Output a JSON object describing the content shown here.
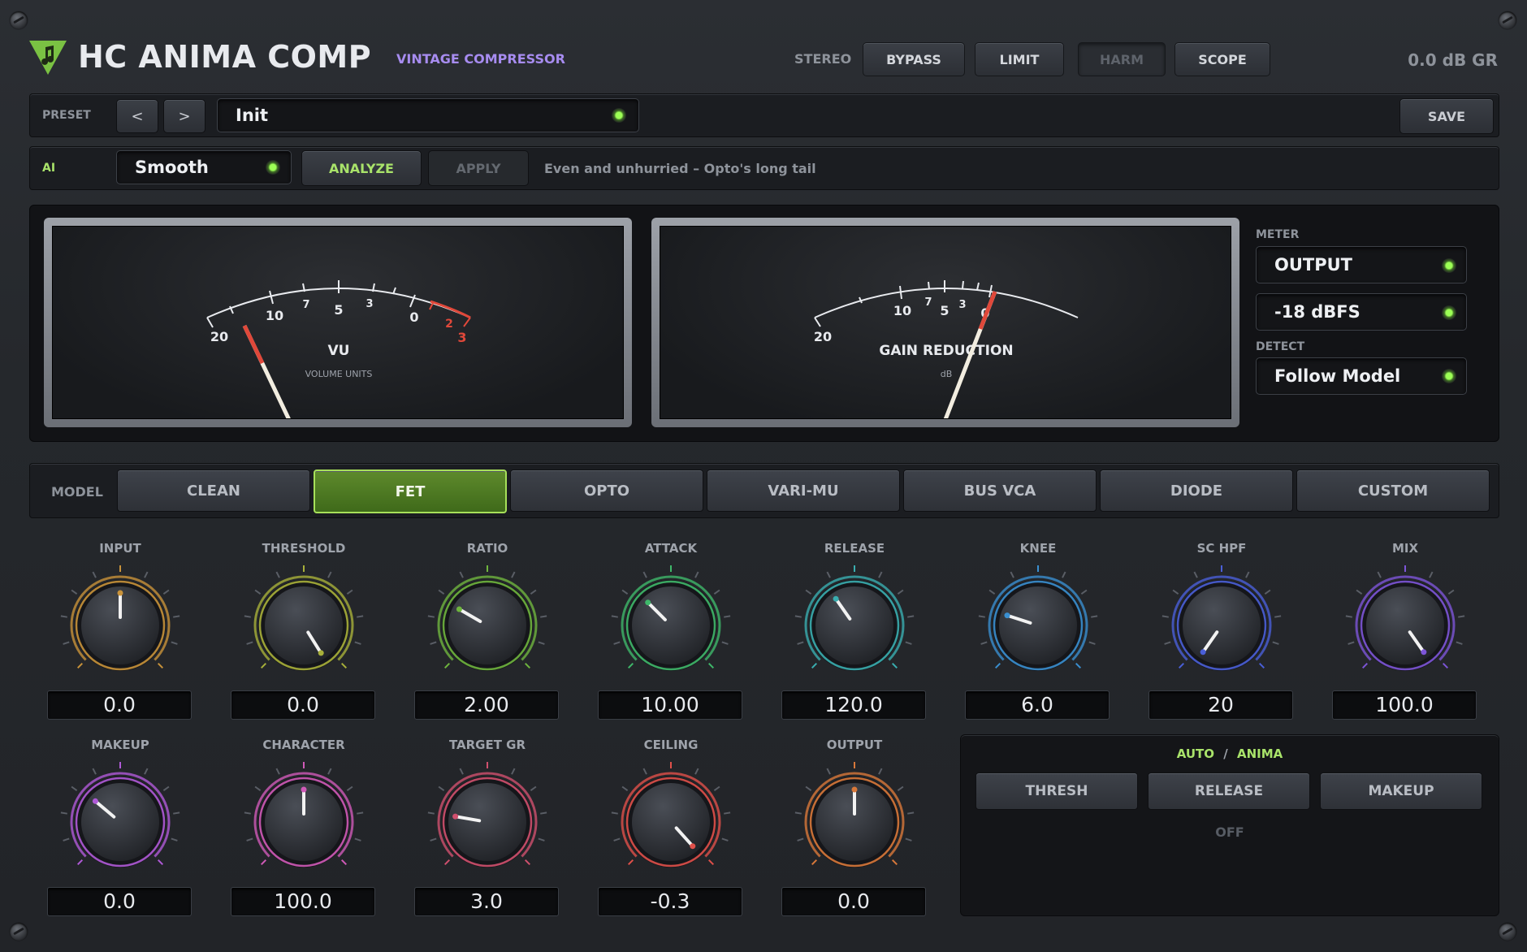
{
  "header": {
    "title": "HC ANIMA COMP",
    "subtitle": "VINTAGE COMPRESSOR",
    "stereo": "STEREO",
    "buttons": [
      "BYPASS",
      "LIMIT",
      "HARM",
      "SCOPE"
    ],
    "gain_reduction": "0.0 dB GR"
  },
  "preset": {
    "label": "PRESET",
    "prev": "<",
    "next": ">",
    "name": "Init",
    "save": "SAVE"
  },
  "ai": {
    "label": "AI",
    "mode": "Smooth",
    "analyze": "ANALYZE",
    "apply": "APPLY",
    "hint": "Even and unhurried – Opto's long tail"
  },
  "vu_meter": {
    "title": "VU",
    "subtitle": "VOLUME UNITS",
    "ticks": [
      "20",
      "10",
      "7",
      "5",
      "3",
      "0",
      "2",
      "3"
    ]
  },
  "gr_meter": {
    "title": "GAIN REDUCTION",
    "subtitle": "dB",
    "ticks": [
      "20",
      "10",
      "7",
      "5",
      "3",
      "0"
    ]
  },
  "meter_side": {
    "meter_label": "METER",
    "meter_source": "OUTPUT",
    "meter_ref": "-18 dBFS",
    "detect_label": "DETECT",
    "detect_mode": "Follow Model"
  },
  "model": {
    "label": "MODEL",
    "options": [
      "CLEAN",
      "FET",
      "OPTO",
      "VARI-MU",
      "BUS VCA",
      "DIODE",
      "CUSTOM"
    ],
    "selected": "FET"
  },
  "knobs_row1": [
    {
      "label": "INPUT",
      "value": "0.0",
      "color": "#c8923a"
    },
    {
      "label": "THRESHOLD",
      "value": "0.0",
      "color": "#a8b03a"
    },
    {
      "label": "RATIO",
      "value": "2.00",
      "color": "#6fb53e"
    },
    {
      "label": "ATTACK",
      "value": "10.00",
      "color": "#3fb86a"
    },
    {
      "label": "RELEASE",
      "value": "120.0",
      "color": "#3aaeb0"
    },
    {
      "label": "KNEE",
      "value": "6.0",
      "color": "#3a8fd0"
    },
    {
      "label": "SC HPF",
      "value": "20",
      "color": "#4a5fd8"
    },
    {
      "label": "MIX",
      "value": "100.0",
      "color": "#7d55d8"
    }
  ],
  "knobs_row2": [
    {
      "label": "MAKEUP",
      "value": "0.0",
      "color": "#b05ad8"
    },
    {
      "label": "CHARACTER",
      "value": "100.0",
      "color": "#d05ab8"
    },
    {
      "label": "TARGET GR",
      "value": "3.0",
      "color": "#d0506e"
    },
    {
      "label": "CEILING",
      "value": "-0.3",
      "color": "#e0504a"
    },
    {
      "label": "OUTPUT",
      "value": "0.0",
      "color": "#d8783a"
    }
  ],
  "auto": {
    "auto": "AUTO",
    "slash": "/",
    "anima": "ANIMA",
    "buttons": [
      "THRESH",
      "RELEASE",
      "MAKEUP"
    ],
    "state": "OFF"
  }
}
